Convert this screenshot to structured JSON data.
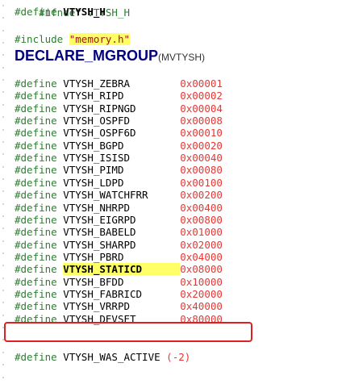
{
  "editor": {
    "header": {
      "ifndef": "#ifndef VTYSH_H",
      "define_kw": "#define",
      "define_name": "VTYSH_H"
    },
    "include": {
      "kw": "#include",
      "file": "\"memory.h\""
    },
    "declare": {
      "macro": "DECLARE_MGROUP",
      "args": "(MVTYSH)"
    },
    "defines": [
      {
        "kw": "#define",
        "name": "VTYSH_ZEBRA",
        "value": "0x00001"
      },
      {
        "kw": "#define",
        "name": "VTYSH_RIPD",
        "value": "0x00002"
      },
      {
        "kw": "#define",
        "name": "VTYSH_RIPNGD",
        "value": "0x00004"
      },
      {
        "kw": "#define",
        "name": "VTYSH_OSPFD",
        "value": "0x00008"
      },
      {
        "kw": "#define",
        "name": "VTYSH_OSPF6D",
        "value": "0x00010"
      },
      {
        "kw": "#define",
        "name": "VTYSH_BGPD",
        "value": "0x00020"
      },
      {
        "kw": "#define",
        "name": "VTYSH_ISISD",
        "value": "0x00040"
      },
      {
        "kw": "#define",
        "name": "VTYSH_PIMD",
        "value": "0x00080"
      },
      {
        "kw": "#define",
        "name": "VTYSH_LDPD",
        "value": "0x00100"
      },
      {
        "kw": "#define",
        "name": "VTYSH_WATCHFRR",
        "value": "0x00200"
      },
      {
        "kw": "#define",
        "name": "VTYSH_NHRPD",
        "value": "0x00400"
      },
      {
        "kw": "#define",
        "name": "VTYSH_EIGRPD",
        "value": "0x00800"
      },
      {
        "kw": "#define",
        "name": "VTYSH_BABELD",
        "value": "0x01000"
      },
      {
        "kw": "#define",
        "name": "VTYSH_SHARPD",
        "value": "0x02000"
      },
      {
        "kw": "#define",
        "name": "VTYSH_PBRD",
        "value": "0x04000"
      },
      {
        "kw": "#define",
        "name": "VTYSH_STATICD",
        "value": "0x08000"
      },
      {
        "kw": "#define",
        "name": "VTYSH_BFDD",
        "value": "0x10000"
      },
      {
        "kw": "#define",
        "name": "VTYSH_FABRICD",
        "value": "0x20000"
      },
      {
        "kw": "#define",
        "name": "VTYSH_VRRPD",
        "value": "0x40000"
      },
      {
        "kw": "#define",
        "name": "VTYSH_DEVSET",
        "value": "0x80000"
      }
    ],
    "was_active": {
      "kw": "#define",
      "name": "VTYSH_WAS_ACTIVE",
      "value": "(-2)"
    }
  },
  "colors": {
    "keyword": "#2e7d32",
    "value": "#e53935",
    "highlight": "#ffff66",
    "annotation_box": "#e02020"
  }
}
